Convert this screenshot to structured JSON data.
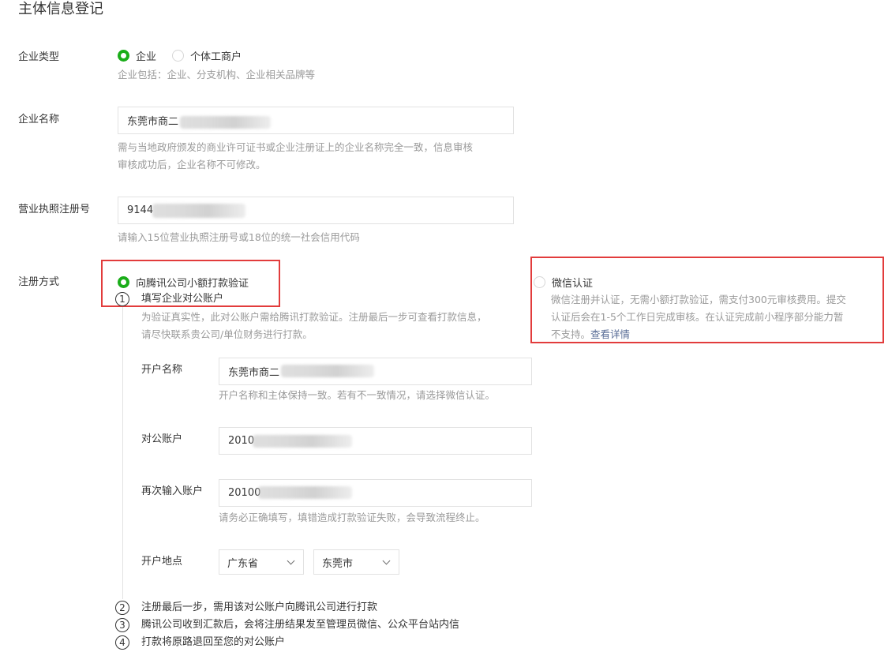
{
  "page_title": "主体信息登记",
  "company_type": {
    "label": "企业类型",
    "options": [
      {
        "label": "企业",
        "checked": true
      },
      {
        "label": "个体工商户",
        "checked": false
      }
    ],
    "hint": "企业包括：企业、分支机构、企业相关品牌等"
  },
  "company_name": {
    "label": "企业名称",
    "value": "东莞市商二",
    "hint_line1": "需与当地政府颁发的商业许可证书或企业注册证上的企业名称完全一致，信息审核",
    "hint_line2": "审核成功后，企业名称不可修改。"
  },
  "license": {
    "label": "营业执照注册号",
    "value": "9144",
    "hint": "请输入15位营业执照注册号或18位的统一社会信用代码"
  },
  "register_method": {
    "label": "注册方式",
    "option_bank": "向腾讯公司小额打款验证",
    "option_wechat": "微信认证",
    "wechat_desc_line1": "微信注册并认证，无需小额打款验证，需支付300元审核费用。提交",
    "wechat_desc_line2": "认证后会在1-5个工作日完成审核。在认证完成前小程序部分能力暂",
    "wechat_desc_line3": "不支持。",
    "wechat_link": "查看详情"
  },
  "steps": {
    "step1": {
      "num": "1",
      "title": "填写企业对公账户"
    },
    "step1_hint_line1": "为验证真实性，此对公账户需给腾讯打款验证。注册最后一步可查看打款信息，",
    "step1_hint_line2": "请尽快联系贵公司/单位财务进行打款。",
    "step2": {
      "num": "2",
      "text": "注册最后一步，需用该对公账户向腾讯公司进行打款"
    },
    "step3": {
      "num": "3",
      "text": "腾讯公司收到汇款后，会将注册结果发至管理员微信、公众平台站内信"
    },
    "step4": {
      "num": "4",
      "text": "打款将原路退回至您的对公账户"
    }
  },
  "bank_form": {
    "account_name": {
      "label": "开户名称",
      "value": "东莞市商二",
      "hint": "开户名称和主体保持一致。若有不一致情况，请选择微信认证。"
    },
    "account_no": {
      "label": "对公账户",
      "value": "2010"
    },
    "account_no_confirm": {
      "label": "再次输入账户",
      "value": "20100",
      "hint": "请务必正确填写，填错造成打款验证失败，会导致流程终止。"
    },
    "location": {
      "label": "开户地点",
      "province": "广东省",
      "city": "东莞市"
    }
  },
  "colors": {
    "accent_green": "#1aad19",
    "highlight_red": "#e23c3c",
    "link": "#576b95"
  }
}
